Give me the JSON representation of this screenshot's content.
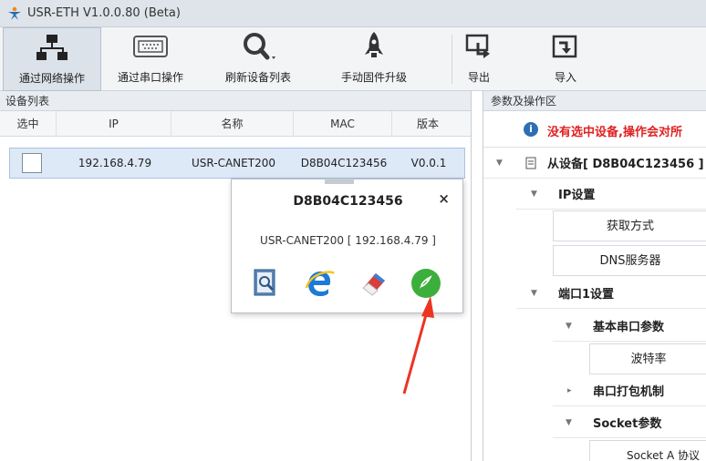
{
  "window": {
    "title": "USR-ETH V1.0.0.80 (Beta)"
  },
  "toolbar": {
    "items": [
      {
        "label": "通过网络操作",
        "icon": "network-icon"
      },
      {
        "label": "通过串口操作",
        "icon": "serial-port-icon"
      },
      {
        "label": "刷新设备列表",
        "icon": "search-icon"
      },
      {
        "label": "手动固件升级",
        "icon": "rocket-icon"
      },
      {
        "label": "导出",
        "icon": "export-icon"
      },
      {
        "label": "导入",
        "icon": "import-icon"
      }
    ]
  },
  "left_panel": {
    "header": "设备列表",
    "columns": [
      "选中",
      "IP",
      "名称",
      "MAC",
      "版本"
    ],
    "rows": [
      {
        "ip": "192.168.4.79",
        "name": "USR-CANET200",
        "mac": "D8B04C123456",
        "version": "V0.0.1",
        "selected": false
      }
    ]
  },
  "popup": {
    "title": "D8B04C123456",
    "close": "×",
    "subtitle": "USR-CANET200  [ 192.168.4.79 ]",
    "icons": [
      "inspect-icon",
      "browser-icon",
      "eraser-icon",
      "upgrade-rocket-icon"
    ]
  },
  "right_panel": {
    "header": "参数及操作区",
    "notice": "没有选中设备,操作会对所",
    "tree": {
      "root": "从设备[ D8B04C123456 ]",
      "ip_group": "IP设置",
      "ip_fields": [
        "获取方式",
        "DNS服务器"
      ],
      "port_group": "端口1设置",
      "serial_group": "基本串口参数",
      "serial_fields": [
        "波特率"
      ],
      "packet_group": "串口打包机制",
      "socket_group": "Socket参数",
      "socket_fields": [
        "Socket A 协议"
      ]
    }
  },
  "colors": {
    "accent": "#2e6fb4",
    "warning": "#e02020",
    "selection": "#dde9f6",
    "arrow": "#ee3322"
  }
}
